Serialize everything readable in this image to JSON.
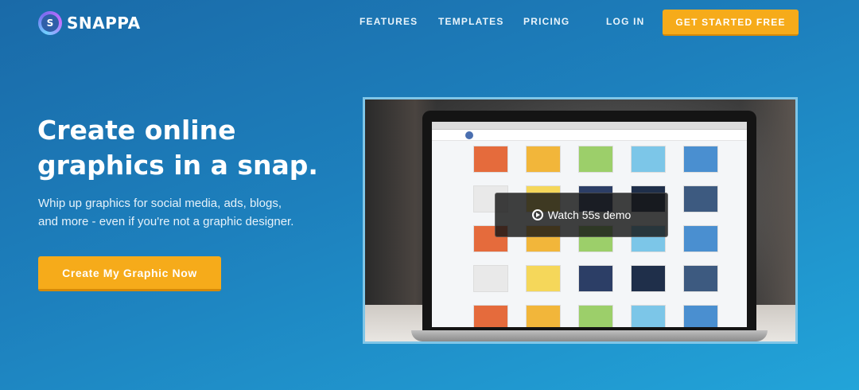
{
  "brand": {
    "name": "SNAPPA",
    "mark_letter": "S"
  },
  "nav": {
    "items": [
      "FEATURES",
      "TEMPLATES",
      "PRICING",
      "LOG IN"
    ],
    "cta": "GET STARTED FREE"
  },
  "hero": {
    "title_line1": "Create online",
    "title_line2": "graphics in a snap.",
    "subtitle_line1": "Whip up graphics for social media, ads, blogs,",
    "subtitle_line2": "and more - even if you're not a graphic designer.",
    "cta": "Create My Graphic Now"
  },
  "video": {
    "overlay_label": "Watch 55s demo",
    "icon": "play-circle-icon"
  },
  "colors": {
    "accent": "#f6ab1a",
    "background_start": "#1a6aa8",
    "background_end": "#22a4d9"
  }
}
